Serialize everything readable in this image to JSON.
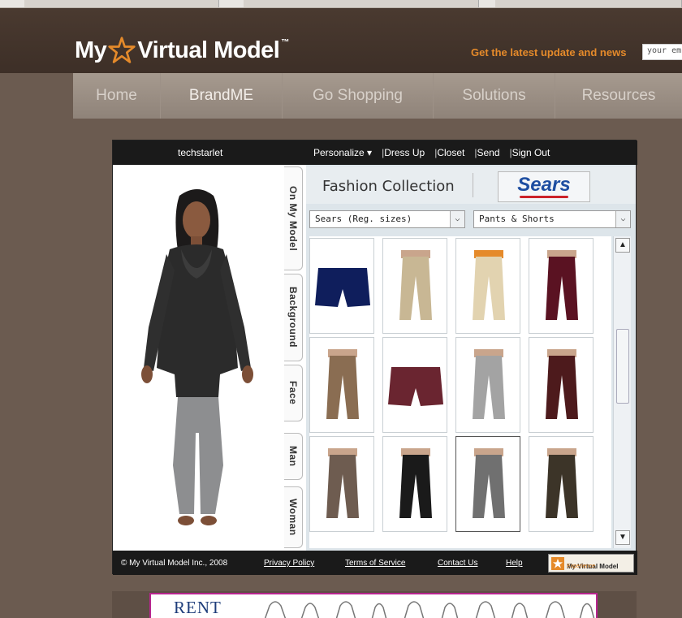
{
  "header": {
    "logo_text_left": "My",
    "logo_text_right": "Virtual Model",
    "logo_tm": "™",
    "news_text": "Get the latest update and news",
    "email_placeholder": "your em"
  },
  "nav": {
    "items": [
      "Home",
      "BrandME",
      "Go Shopping",
      "Solutions",
      "Resources"
    ],
    "active": "BrandME"
  },
  "app": {
    "username": "techstarlet",
    "menu": [
      "Personalize ▾",
      "Dress Up",
      "Closet",
      "Send",
      "Sign Out"
    ],
    "side_tabs": [
      "On My Model",
      "Background",
      "Face",
      "Man",
      "Woman"
    ],
    "collection_title": "Fashion Collection",
    "brand_logo": "Sears",
    "filter_size": "Sears (Reg. sizes)",
    "filter_category": "Pants & Shorts",
    "scroll_up_icon": "▲",
    "scroll_down_icon": "▼",
    "footer": {
      "copyright": "© My Virtual Model Inc., 2008",
      "links": [
        "Privacy Policy",
        "Terms of Service",
        "Contact Us",
        "Help"
      ],
      "badge_title": "My Virtual Model",
      "badge_sub": "Experience"
    },
    "products": [
      {
        "item": "navy shorts",
        "color": "#0f1e5c"
      },
      {
        "item": "khaki pants",
        "color": "#c8b794"
      },
      {
        "item": "cream pants",
        "color": "#e2d3b0"
      },
      {
        "item": "burgundy pants",
        "color": "#5a1222"
      },
      {
        "item": "brown pants",
        "color": "#8a6d52"
      },
      {
        "item": "burgundy shorts",
        "color": "#6a2530"
      },
      {
        "item": "grey pants",
        "color": "#a3a3a3"
      },
      {
        "item": "burgundy trousers",
        "color": "#4d1a1c"
      },
      {
        "item": "taupe pants",
        "color": "#6e5c50"
      },
      {
        "item": "black pants",
        "color": "#1a1a1a"
      },
      {
        "item": "grey trousers",
        "color": "#707070"
      },
      {
        "item": "olive pants",
        "color": "#3c3428"
      }
    ]
  },
  "banner": {
    "text": "RENT"
  },
  "colors": {
    "accent_orange": "#e58a2a",
    "sears_blue": "#1e4ea1"
  }
}
